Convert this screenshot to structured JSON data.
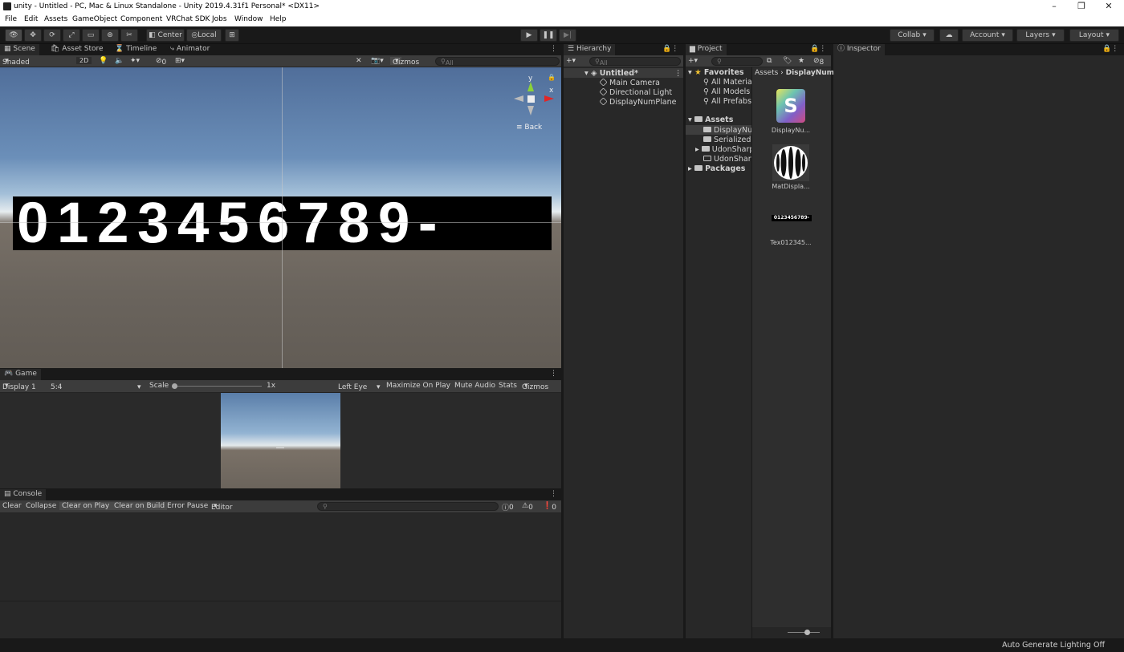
{
  "window": {
    "title": "unity - Untitled - PC, Mac & Linux Standalone - Unity 2019.4.31f1 Personal* <DX11>",
    "minimize": "–",
    "restore": "❐",
    "close": "✕"
  },
  "menu": [
    "File",
    "Edit",
    "Assets",
    "GameObject",
    "Component",
    "VRChat SDK",
    "Jobs",
    "Window",
    "Help"
  ],
  "toolbar": {
    "pivot_mode": "Center",
    "pivot_rotation": "Local",
    "collab": "Collab",
    "account": "Account",
    "layers": "Layers",
    "layout": "Layout"
  },
  "scene_tabs": {
    "scene": "Scene",
    "asset_store": "Asset Store",
    "timeline": "Timeline",
    "animator": "Animator"
  },
  "scene_toolbar": {
    "shading": "Shaded",
    "mode_2d": "2D",
    "hidden_count": "0",
    "gizmos": "Gizmos",
    "search_placeholder": "All"
  },
  "scene_view": {
    "display_text": "0123456789-",
    "gizmo_y": "y",
    "gizmo_x": "x",
    "back_label": "Back"
  },
  "game": {
    "tab": "Game",
    "display": "Display 1",
    "aspect": "5:4",
    "scale_label": "Scale",
    "scale_value": "1x",
    "eye": "Left Eye",
    "maximize": "Maximize On Play",
    "mute": "Mute Audio",
    "stats": "Stats",
    "gizmos": "Gizmos"
  },
  "console": {
    "tab": "Console",
    "clear": "Clear",
    "collapse": "Collapse",
    "clear_on_play": "Clear on Play",
    "clear_on_build": "Clear on Build",
    "error_pause": "Error Pause",
    "editor": "Editor",
    "info_count": "0",
    "warning_count": "0",
    "error_count": "0"
  },
  "hierarchy": {
    "tab": "Hierarchy",
    "search_placeholder": "All",
    "scene": "Untitled*",
    "items": [
      "Main Camera",
      "Directional Light",
      "DisplayNumPlane"
    ]
  },
  "project": {
    "tab": "Project",
    "hidden_count": "8",
    "favorites": {
      "label": "Favorites",
      "items": [
        "All Materia",
        "All Models",
        "All Prefabs"
      ]
    },
    "assets": {
      "label": "Assets",
      "folders": [
        "DisplayNur",
        "SerializedU",
        "UdonSharp",
        "UdonSharp"
      ]
    },
    "packages": "Packages",
    "breadcrumb": {
      "root": "Assets",
      "current": "DisplayNum"
    },
    "files": [
      {
        "name": "DisplayNu...",
        "icon": "udonsharp-script-icon",
        "glyph": "S"
      },
      {
        "name": "MatDispla...",
        "icon": "material-sphere-icon"
      },
      {
        "name": "Tex012345...",
        "icon": "texture-thumbnail-icon",
        "thumb_text": "0123456789-"
      }
    ]
  },
  "inspector": {
    "tab": "Inspector"
  },
  "status": {
    "right_text": "Auto Generate Lighting Off"
  }
}
